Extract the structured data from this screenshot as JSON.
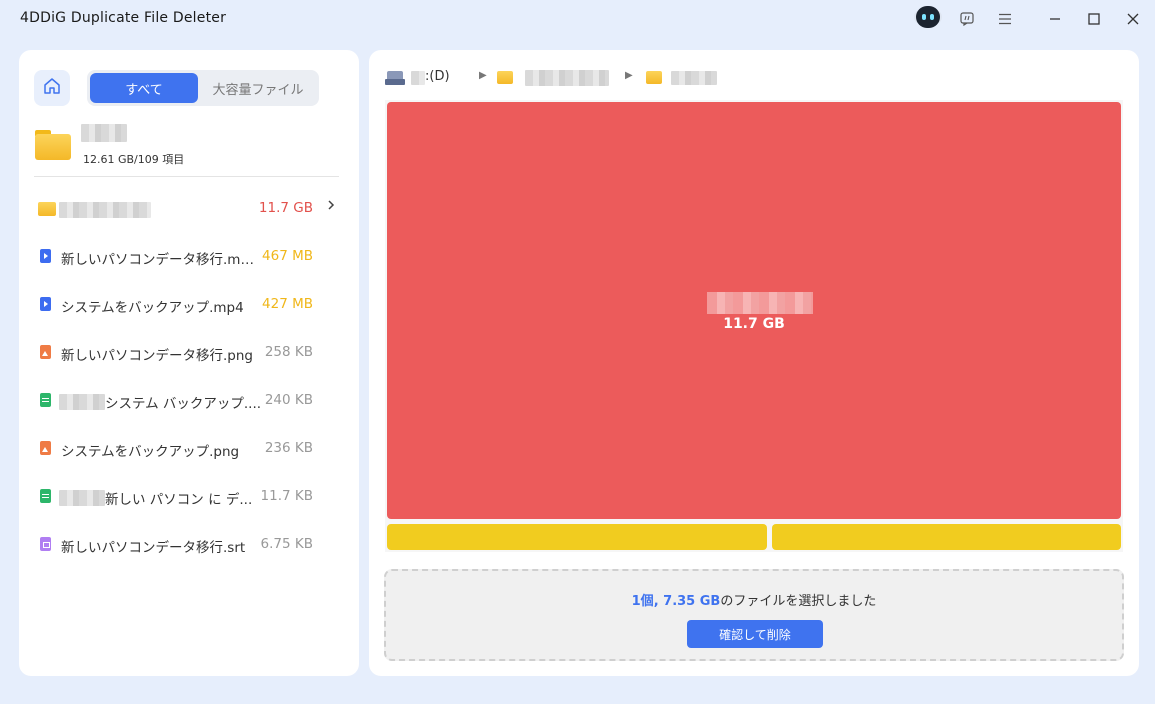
{
  "window": {
    "title": "4DDiG Duplicate File Deleter"
  },
  "titlebar_icons": [
    "robot-assistant-icon",
    "feedback-icon",
    "menu-icon",
    "minimize-icon",
    "maximize-icon",
    "close-icon"
  ],
  "left": {
    "tabs": [
      {
        "label": "すべて",
        "active": true
      },
      {
        "label": "大容量ファイル",
        "active": false
      }
    ],
    "current_folder": {
      "summary": "12.61 GB/109 項目"
    },
    "items": [
      {
        "type": "folder",
        "name": "",
        "size": "11.7 GB",
        "size_color": "#e2514c",
        "has_chevron": true
      },
      {
        "type": "video",
        "name": "新しいパソコンデータ移行.mp4",
        "size": "467 MB",
        "size_color": "#f0b71a"
      },
      {
        "type": "video",
        "name": "システムをバックアップ.mp4",
        "size": "427 MB",
        "size_color": "#f0b71a"
      },
      {
        "type": "image",
        "name": "新しいパソコンデータ移行.png",
        "size": "258 KB",
        "size_color": "#999999"
      },
      {
        "type": "doc",
        "name": "システム バックアップ....",
        "size": "240 KB",
        "size_color": "#999999"
      },
      {
        "type": "image",
        "name": "システムをバックアップ.png",
        "size": "236 KB",
        "size_color": "#999999"
      },
      {
        "type": "doc",
        "name": "新しい パソコン に デ...",
        "size": "11.7 KB",
        "size_color": "#999999"
      },
      {
        "type": "subtitle",
        "name": "新しいパソコンデータ移行.srt",
        "size": "6.75 KB",
        "size_color": "#999999"
      }
    ]
  },
  "right": {
    "breadcrumb": {
      "drive": ":(D)"
    },
    "treemap": {
      "main_size": "11.7 GB"
    },
    "selection": {
      "count": "1個",
      "sep": ", ",
      "size": "7.35 GB",
      "suffix": "のファイルを選択しました"
    },
    "delete_button": "確認して削除"
  },
  "colors": {
    "accent": "#3f73ef",
    "treemap_red": "#ec5b5b",
    "treemap_yellow": "#f1cc1f"
  }
}
